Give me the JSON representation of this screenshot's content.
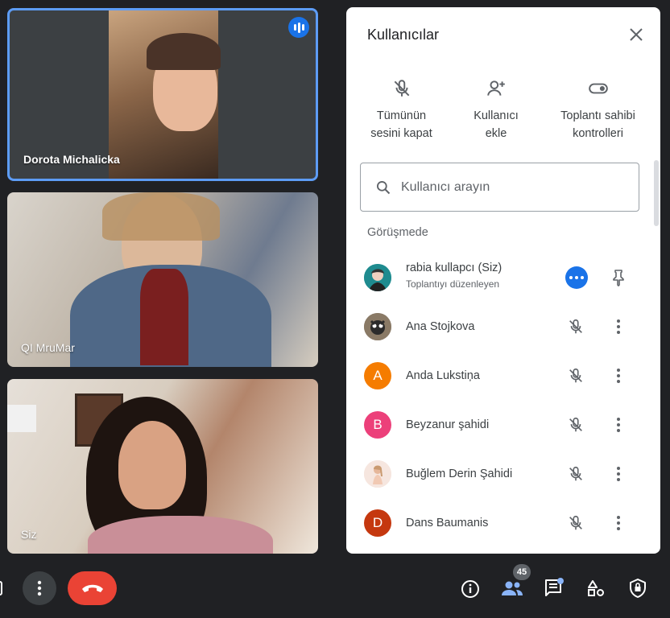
{
  "tiles": [
    {
      "name": "Dorota Michalicka"
    },
    {
      "name": "QI MruMar"
    },
    {
      "name": "Siz"
    }
  ],
  "panel": {
    "title": "Kullanıcılar",
    "actions": [
      {
        "label": "Tümünün\nsesini kapat",
        "icon": "mic-off-icon"
      },
      {
        "label": "Kullanıcı\nekle",
        "icon": "add-person-icon"
      },
      {
        "label": "Toplantı sahibi\nkontrolleri",
        "icon": "toggle-icon"
      }
    ],
    "search_placeholder": "Kullanıcı arayın",
    "section_title": "Görüşmede",
    "participants": [
      {
        "name": "rabia kullapcı (Siz)",
        "subtitle": "Toplantıyı düzenleyen",
        "avatar": "",
        "color": "#2aa6a6"
      },
      {
        "name": "Ana Stojkova",
        "avatar": "",
        "color": "#7a6a5c"
      },
      {
        "name": "Anda Lukstiņa",
        "avatar": "A",
        "color": "#f57c00"
      },
      {
        "name": "Beyzanur şahidi",
        "avatar": "B",
        "color": "#ec407a"
      },
      {
        "name": "Buğlem Derin Şahidi",
        "avatar": "",
        "color": "#f3e0d8"
      },
      {
        "name": "Dans Baumanis",
        "avatar": "D",
        "color": "#c5380f"
      }
    ]
  },
  "bottom_bar": {
    "participant_count": "45"
  },
  "colors": {
    "accent": "#1a73e8",
    "end_call": "#ea4335",
    "background": "#202124"
  }
}
